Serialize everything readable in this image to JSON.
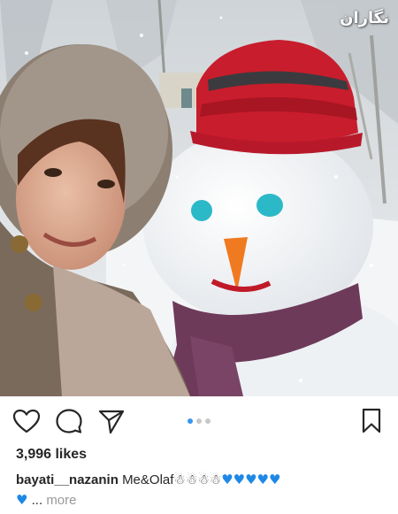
{
  "photo": {
    "watermark": "ﻧﮕﺎﺭﺍﻥ"
  },
  "actions": {
    "like_icon": "heart-outline-icon",
    "comment_icon": "comment-bubble-icon",
    "share_icon": "paper-plane-icon",
    "save_icon": "bookmark-outline-icon"
  },
  "carousel": {
    "count": 3,
    "active_index": 0,
    "active_color": "#3897f0",
    "inactive_color": "#c7c7c7"
  },
  "post": {
    "likes": "3,996 likes",
    "username": "bayati__nazanin",
    "caption_text": "Me&Olaf",
    "caption_emojis": "☃☃☃☃",
    "caption_hearts": "♥♥♥♥♥",
    "caption_heart2": "♥",
    "ellipsis": "...",
    "more_label": "more"
  }
}
